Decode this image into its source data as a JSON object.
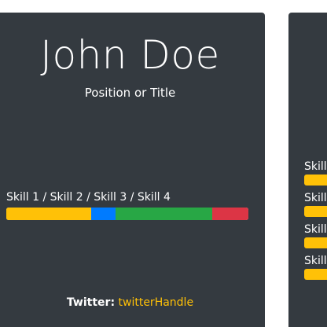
{
  "profile": {
    "name": "John Doe",
    "title": "Position or Title"
  },
  "skills": {
    "label": "Skill 1 / Skill 2 / Skill 3 / Skill 4",
    "segments": [
      {
        "name": "Skill 1",
        "percent": 35,
        "color": "#ffc107"
      },
      {
        "name": "Skill 2",
        "percent": 10,
        "color": "#007bff"
      },
      {
        "name": "Skill 3",
        "percent": 40,
        "color": "#28a745"
      },
      {
        "name": "Skill 4",
        "percent": 15,
        "color": "#dc3545"
      }
    ]
  },
  "twitter": {
    "label": "Twitter:",
    "handle": "twitterHandle"
  },
  "side_card": {
    "items": [
      {
        "label": "Skill",
        "color": "#ffc107"
      },
      {
        "label": "Skill",
        "color": "#ffc107"
      },
      {
        "label": "Skill",
        "color": "#ffc107"
      },
      {
        "label": "Skill",
        "color": "#ffc107"
      }
    ]
  },
  "colors": {
    "card_background": "#343a40",
    "accent": "#ffc107"
  }
}
